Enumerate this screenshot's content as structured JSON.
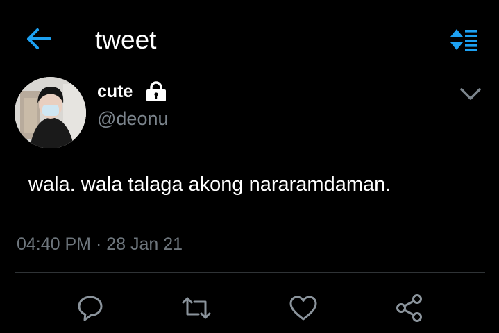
{
  "header": {
    "title": "tweet",
    "back_icon": "arrow-left-icon",
    "sort_icon": "sort-list-icon",
    "accent_color": "#1da1f2"
  },
  "author": {
    "display_name": "cute",
    "handle": "@deonu",
    "protected_icon": "lock-icon",
    "avatar": "profile-photo"
  },
  "tweet": {
    "text": "wala. wala talaga akong nararamdaman.",
    "time": "04:40 PM",
    "separator": "·",
    "date": "28 Jan 21"
  },
  "actions": [
    {
      "name": "reply",
      "icon": "comment-icon"
    },
    {
      "name": "retweet",
      "icon": "retweet-icon"
    },
    {
      "name": "like",
      "icon": "heart-icon"
    },
    {
      "name": "share",
      "icon": "share-icon"
    }
  ],
  "colors": {
    "background": "#000000",
    "text": "#ffffff",
    "secondary_text": "#7c858d",
    "divider": "#2f3336",
    "icon": "#8b949c"
  }
}
